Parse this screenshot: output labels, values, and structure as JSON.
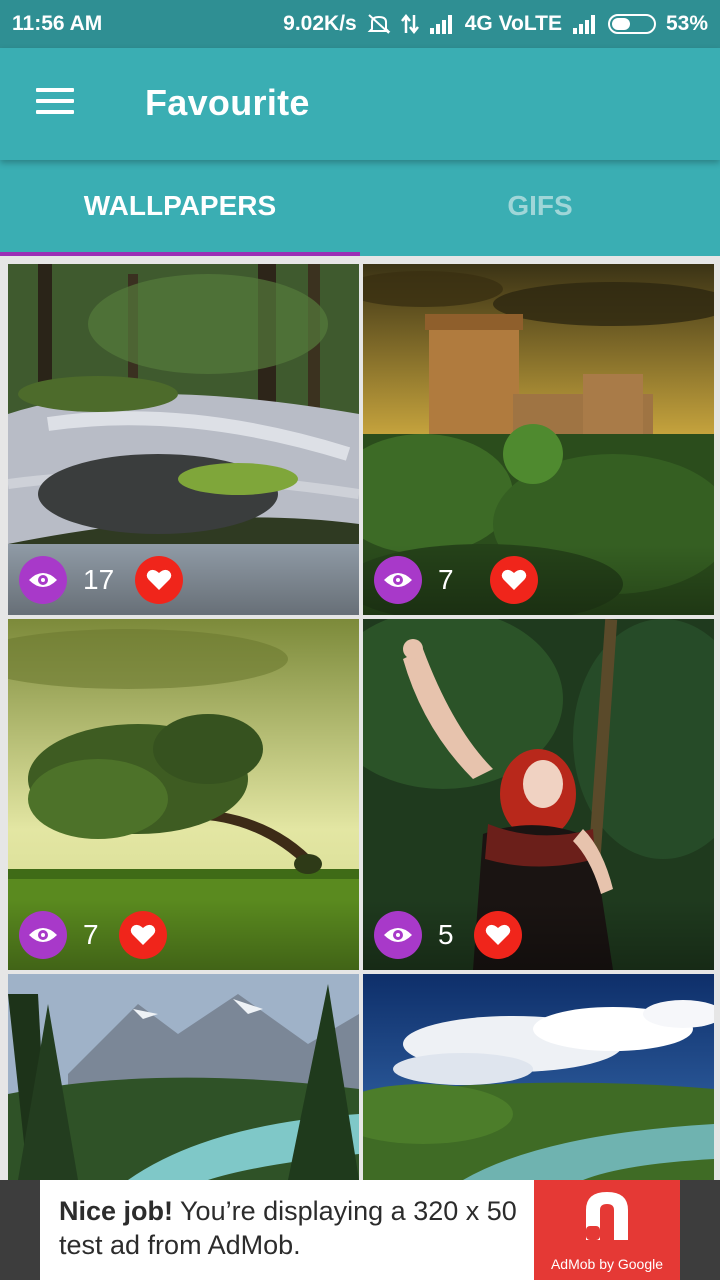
{
  "status_bar": {
    "time": "11:56 AM",
    "speed": "9.02K/s",
    "network": "4G VoLTE",
    "battery": "53%"
  },
  "app_bar": {
    "title": "Favourite"
  },
  "tabs": [
    {
      "label": "WALLPAPERS",
      "active": true
    },
    {
      "label": "GIFS",
      "active": false
    }
  ],
  "wallpapers": [
    {
      "views": "17",
      "favourite": true
    },
    {
      "views": "7",
      "favourite": true
    },
    {
      "views": "7",
      "favourite": true
    },
    {
      "views": "5",
      "favourite": true
    }
  ],
  "ad": {
    "headline": "Nice job!",
    "body": " You’re displaying a 320 x 50 test ad from AdMob.",
    "logo_caption": "AdMob by Google"
  },
  "colors": {
    "primary": "#3aaeb3",
    "status_bar": "#2f8f93",
    "tab_indicator": "#9b2fb5",
    "eye_badge": "#a839c9",
    "heart_badge": "#f0251b"
  }
}
